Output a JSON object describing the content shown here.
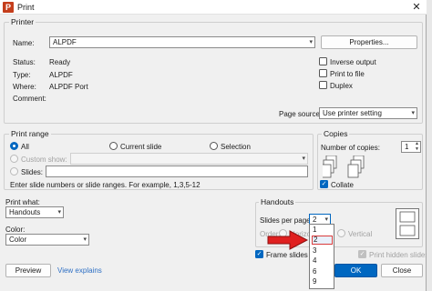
{
  "window": {
    "title": "Print",
    "app_icon": "P",
    "close_glyph": "✕"
  },
  "printer": {
    "group_title": "Printer",
    "name_label": "Name:",
    "name_value": "ALPDF",
    "properties_button": "Properties...",
    "status_label": "Status:",
    "status_value": "Ready",
    "type_label": "Type:",
    "type_value": "ALPDF",
    "where_label": "Where:",
    "where_value": "ALPDF Port",
    "comment_label": "Comment:",
    "inverse_output": "Inverse output",
    "print_to_file": "Print to file",
    "duplex": "Duplex",
    "page_source_label": "Page source:",
    "page_source_value": "Use printer setting"
  },
  "print_range": {
    "group_title": "Print range",
    "all": "All",
    "current_slide": "Current slide",
    "selection": "Selection",
    "custom_show": "Custom show:",
    "slides": "Slides:",
    "hint": "Enter slide numbers or slide ranges. For example, 1,3,5-12"
  },
  "copies": {
    "group_title": "Copies",
    "number_label": "Number of copies:",
    "number_value": "1",
    "collate": "Collate",
    "collate_icon_labels": [
      "1",
      "1",
      "2",
      "2",
      "3",
      "3"
    ]
  },
  "print_what": {
    "label": "Print what:",
    "value": "Handouts",
    "color_label": "Color:",
    "color_value": "Color"
  },
  "handouts": {
    "group_title": "Handouts",
    "slides_per_page_label": "Slides per page:",
    "slides_per_page_value": "2",
    "order_label": "Order:",
    "horizontal": "Horizontal",
    "vertical": "Vertical",
    "options": [
      "1",
      "2",
      "3",
      "4",
      "6",
      "9"
    ],
    "selected_option": "2"
  },
  "options": {
    "frame_slides": "Frame slides",
    "print_hidden_slides": "Print hidden slides"
  },
  "footer": {
    "preview": "Preview",
    "view_explains": "View explains",
    "ok": "OK",
    "close": "Close"
  },
  "colors": {
    "accent": "#0067c0",
    "arrow": "#e02020",
    "app_icon": "#c43e1c"
  }
}
